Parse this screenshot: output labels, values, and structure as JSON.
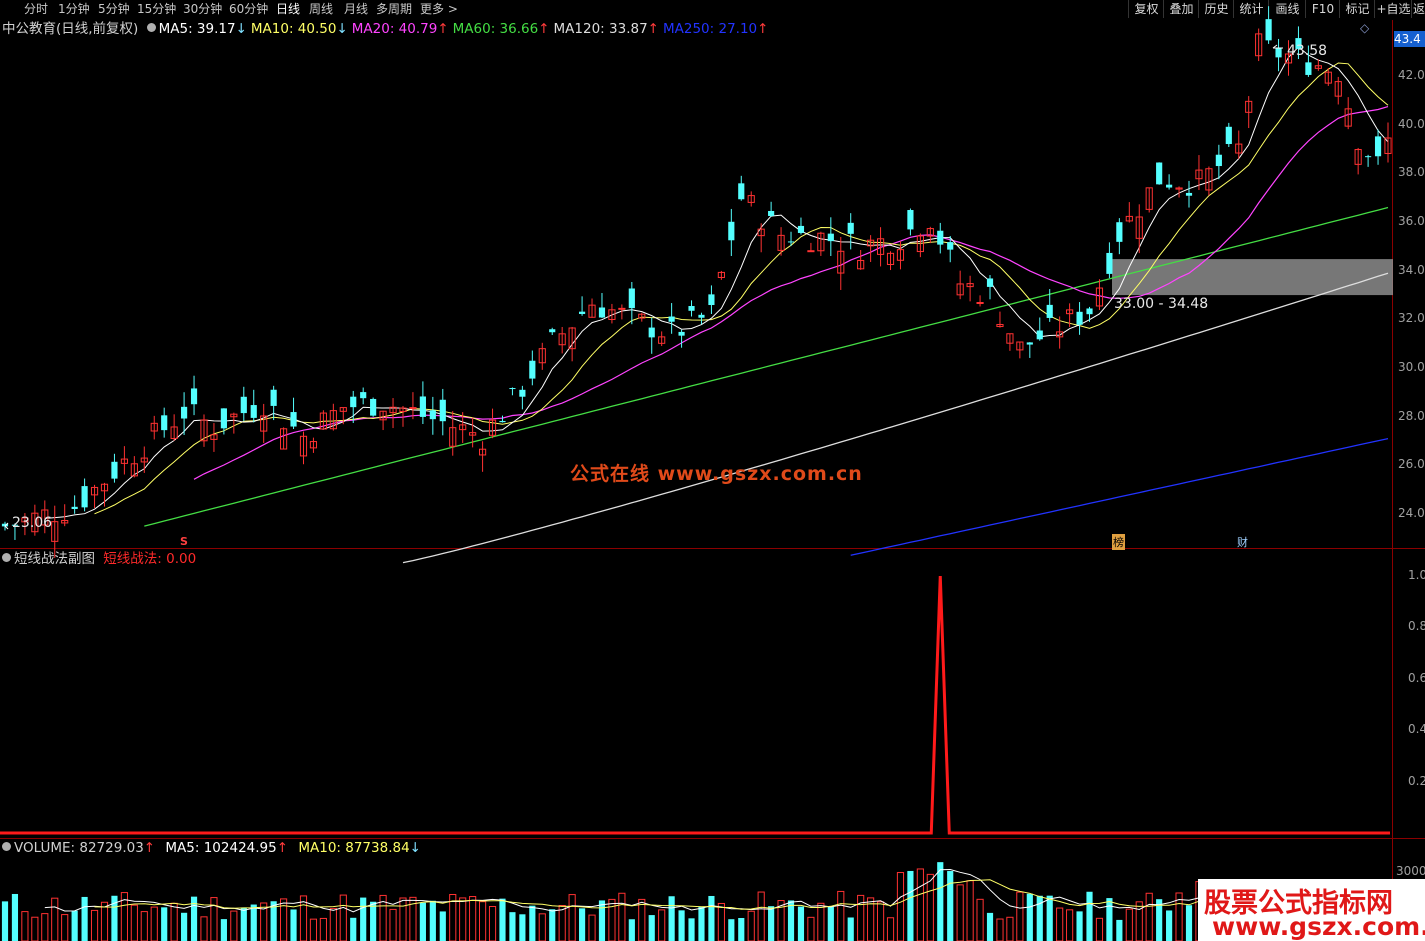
{
  "toolbar": {
    "tabs": [
      "分时",
      "1分钟",
      "5分钟",
      "15分钟",
      "30分钟",
      "60分钟",
      "日线",
      "周线",
      "月线",
      "多周期",
      "更多"
    ],
    "active_tab": "日线",
    "more_arrow": ">",
    "right_buttons": [
      "复权",
      "叠加",
      "历史",
      "统计",
      "画线",
      "F10",
      "标记",
      "+自选",
      "返"
    ]
  },
  "main_header": {
    "stock": "中公教育(日线,前复权)",
    "ma": [
      {
        "label": "MA5: 39.17",
        "dir": "↓",
        "color": "#ffffff"
      },
      {
        "label": "MA10: 40.50",
        "dir": "↓",
        "color": "#ffff66"
      },
      {
        "label": "MA20: 40.79",
        "dir": "↑",
        "color": "#ff44ff"
      },
      {
        "label": "MA60: 36.66",
        "dir": "↑",
        "color": "#44dd44"
      },
      {
        "label": "MA120: 33.87",
        "dir": "↑",
        "color": "#dddddd"
      },
      {
        "label": "MA250: 27.10",
        "dir": "↑",
        "color": "#2233ff"
      }
    ],
    "diamond": "◇"
  },
  "price_axis": {
    "current": "43.4",
    "ticks": [
      "42.0",
      "40.0",
      "38.0",
      "36.0",
      "34.0",
      "32.0",
      "30.0",
      "28.0",
      "26.0",
      "24.0"
    ]
  },
  "annotations": {
    "high": "43.58",
    "low": "23.06",
    "zone": "33.00 - 34.48",
    "marker_s": "S",
    "marker_bang": "榜",
    "marker_cai": "财"
  },
  "watermark1": "公式在线 www.gszx.com.cn",
  "indicator_header": {
    "name": "短线战法副图",
    "series": "短线战法: 0.00"
  },
  "indicator_axis": [
    "1.0",
    "0.8",
    "0.6",
    "0.4",
    "0.2"
  ],
  "volume_header": {
    "volume": "VOLUME: 82729.03",
    "volume_dir": "↑",
    "ma5": "MA5: 102424.95",
    "ma5_dir": "↑",
    "ma10": "MA10: 87738.84",
    "ma10_dir": "↓"
  },
  "volume_axis": [
    "3000"
  ],
  "watermark2": {
    "line1": "股票公式指标网",
    "line2": "www.gszx.com.cn"
  },
  "colors": {
    "up": "#ff3232",
    "down": "#54ffff",
    "ma5": "#ffffff",
    "ma10": "#ffff66",
    "ma20": "#ff44ff",
    "ma60": "#44dd44",
    "ma120": "#dddddd",
    "ma250": "#2233ff",
    "signal": "#ff1a1a",
    "zone": "#8c8c8c"
  },
  "chart_data": {
    "type": "candlestick",
    "price_range": [
      22.6,
      43.9
    ],
    "signal": {
      "type": "line",
      "range": [
        0,
        1
      ],
      "spike_index": 94,
      "spike_value": 1.0,
      "current": 0.0
    }
  }
}
